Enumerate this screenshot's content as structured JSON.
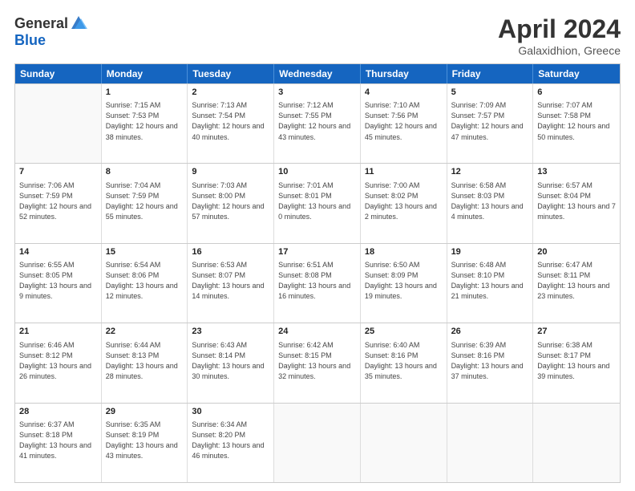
{
  "header": {
    "logo_general": "General",
    "logo_blue": "Blue",
    "title": "April 2024",
    "location": "Galaxidhion, Greece"
  },
  "weekdays": [
    "Sunday",
    "Monday",
    "Tuesday",
    "Wednesday",
    "Thursday",
    "Friday",
    "Saturday"
  ],
  "weeks": [
    [
      {
        "day": "",
        "empty": true
      },
      {
        "day": "1",
        "sunrise": "7:15 AM",
        "sunset": "7:53 PM",
        "daylight": "12 hours and 38 minutes."
      },
      {
        "day": "2",
        "sunrise": "7:13 AM",
        "sunset": "7:54 PM",
        "daylight": "12 hours and 40 minutes."
      },
      {
        "day": "3",
        "sunrise": "7:12 AM",
        "sunset": "7:55 PM",
        "daylight": "12 hours and 43 minutes."
      },
      {
        "day": "4",
        "sunrise": "7:10 AM",
        "sunset": "7:56 PM",
        "daylight": "12 hours and 45 minutes."
      },
      {
        "day": "5",
        "sunrise": "7:09 AM",
        "sunset": "7:57 PM",
        "daylight": "12 hours and 47 minutes."
      },
      {
        "day": "6",
        "sunrise": "7:07 AM",
        "sunset": "7:58 PM",
        "daylight": "12 hours and 50 minutes."
      }
    ],
    [
      {
        "day": "7",
        "sunrise": "7:06 AM",
        "sunset": "7:59 PM",
        "daylight": "12 hours and 52 minutes."
      },
      {
        "day": "8",
        "sunrise": "7:04 AM",
        "sunset": "7:59 PM",
        "daylight": "12 hours and 55 minutes."
      },
      {
        "day": "9",
        "sunrise": "7:03 AM",
        "sunset": "8:00 PM",
        "daylight": "12 hours and 57 minutes."
      },
      {
        "day": "10",
        "sunrise": "7:01 AM",
        "sunset": "8:01 PM",
        "daylight": "13 hours and 0 minutes."
      },
      {
        "day": "11",
        "sunrise": "7:00 AM",
        "sunset": "8:02 PM",
        "daylight": "13 hours and 2 minutes."
      },
      {
        "day": "12",
        "sunrise": "6:58 AM",
        "sunset": "8:03 PM",
        "daylight": "13 hours and 4 minutes."
      },
      {
        "day": "13",
        "sunrise": "6:57 AM",
        "sunset": "8:04 PM",
        "daylight": "13 hours and 7 minutes."
      }
    ],
    [
      {
        "day": "14",
        "sunrise": "6:55 AM",
        "sunset": "8:05 PM",
        "daylight": "13 hours and 9 minutes."
      },
      {
        "day": "15",
        "sunrise": "6:54 AM",
        "sunset": "8:06 PM",
        "daylight": "13 hours and 12 minutes."
      },
      {
        "day": "16",
        "sunrise": "6:53 AM",
        "sunset": "8:07 PM",
        "daylight": "13 hours and 14 minutes."
      },
      {
        "day": "17",
        "sunrise": "6:51 AM",
        "sunset": "8:08 PM",
        "daylight": "13 hours and 16 minutes."
      },
      {
        "day": "18",
        "sunrise": "6:50 AM",
        "sunset": "8:09 PM",
        "daylight": "13 hours and 19 minutes."
      },
      {
        "day": "19",
        "sunrise": "6:48 AM",
        "sunset": "8:10 PM",
        "daylight": "13 hours and 21 minutes."
      },
      {
        "day": "20",
        "sunrise": "6:47 AM",
        "sunset": "8:11 PM",
        "daylight": "13 hours and 23 minutes."
      }
    ],
    [
      {
        "day": "21",
        "sunrise": "6:46 AM",
        "sunset": "8:12 PM",
        "daylight": "13 hours and 26 minutes."
      },
      {
        "day": "22",
        "sunrise": "6:44 AM",
        "sunset": "8:13 PM",
        "daylight": "13 hours and 28 minutes."
      },
      {
        "day": "23",
        "sunrise": "6:43 AM",
        "sunset": "8:14 PM",
        "daylight": "13 hours and 30 minutes."
      },
      {
        "day": "24",
        "sunrise": "6:42 AM",
        "sunset": "8:15 PM",
        "daylight": "13 hours and 32 minutes."
      },
      {
        "day": "25",
        "sunrise": "6:40 AM",
        "sunset": "8:16 PM",
        "daylight": "13 hours and 35 minutes."
      },
      {
        "day": "26",
        "sunrise": "6:39 AM",
        "sunset": "8:16 PM",
        "daylight": "13 hours and 37 minutes."
      },
      {
        "day": "27",
        "sunrise": "6:38 AM",
        "sunset": "8:17 PM",
        "daylight": "13 hours and 39 minutes."
      }
    ],
    [
      {
        "day": "28",
        "sunrise": "6:37 AM",
        "sunset": "8:18 PM",
        "daylight": "13 hours and 41 minutes."
      },
      {
        "day": "29",
        "sunrise": "6:35 AM",
        "sunset": "8:19 PM",
        "daylight": "13 hours and 43 minutes."
      },
      {
        "day": "30",
        "sunrise": "6:34 AM",
        "sunset": "8:20 PM",
        "daylight": "13 hours and 46 minutes."
      },
      {
        "day": "",
        "empty": true
      },
      {
        "day": "",
        "empty": true
      },
      {
        "day": "",
        "empty": true
      },
      {
        "day": "",
        "empty": true
      }
    ]
  ]
}
